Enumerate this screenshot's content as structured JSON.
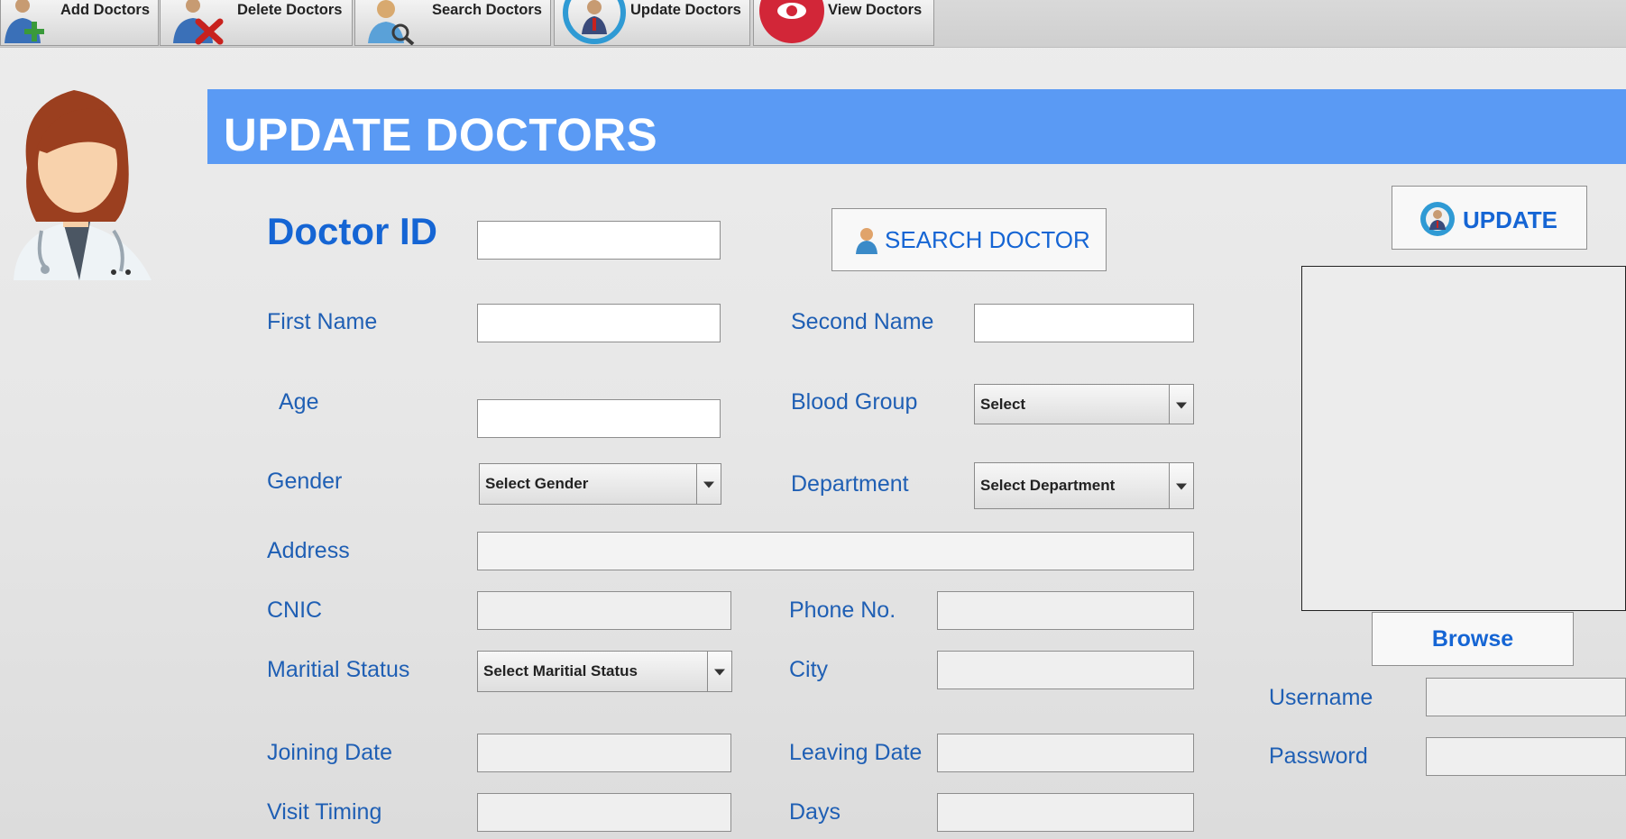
{
  "toolbar": {
    "add": "Add Doctors",
    "delete": "Delete Doctors",
    "search": "Search Doctors",
    "update": "Update Doctors",
    "view": "View Doctors"
  },
  "header": {
    "title": "UPDATE DOCTORS"
  },
  "form": {
    "doctor_id": {
      "label": "Doctor ID",
      "value": ""
    },
    "search_button": "SEARCH DOCTOR",
    "update_button": "UPDATE",
    "first_name": {
      "label": "First Name",
      "value": ""
    },
    "second_name": {
      "label": "Second Name",
      "value": ""
    },
    "age": {
      "label": "Age",
      "value": ""
    },
    "blood_group": {
      "label": "Blood Group",
      "value": "Select"
    },
    "gender": {
      "label": "Gender",
      "value": "Select Gender"
    },
    "department": {
      "label": "Department",
      "value": "Select Department"
    },
    "address": {
      "label": "Address",
      "value": ""
    },
    "cnic": {
      "label": "CNIC",
      "value": ""
    },
    "phone": {
      "label": "Phone No.",
      "value": ""
    },
    "marital_status": {
      "label": "Maritial Status",
      "value": "Select Maritial Status"
    },
    "city": {
      "label": "City",
      "value": ""
    },
    "joining_date": {
      "label": "Joining Date",
      "value": ""
    },
    "leaving_date": {
      "label": "Leaving Date",
      "value": ""
    },
    "visit_timing": {
      "label": "Visit Timing",
      "value": ""
    },
    "days": {
      "label": "Days",
      "value": ""
    }
  },
  "photo": {
    "browse_button": "Browse"
  },
  "account": {
    "username": {
      "label": "Username",
      "value": ""
    },
    "password": {
      "label": "Password",
      "value": ""
    }
  },
  "colors": {
    "banner": "#5a9af4",
    "label": "#1f5fb4",
    "accent": "#1565d4"
  }
}
